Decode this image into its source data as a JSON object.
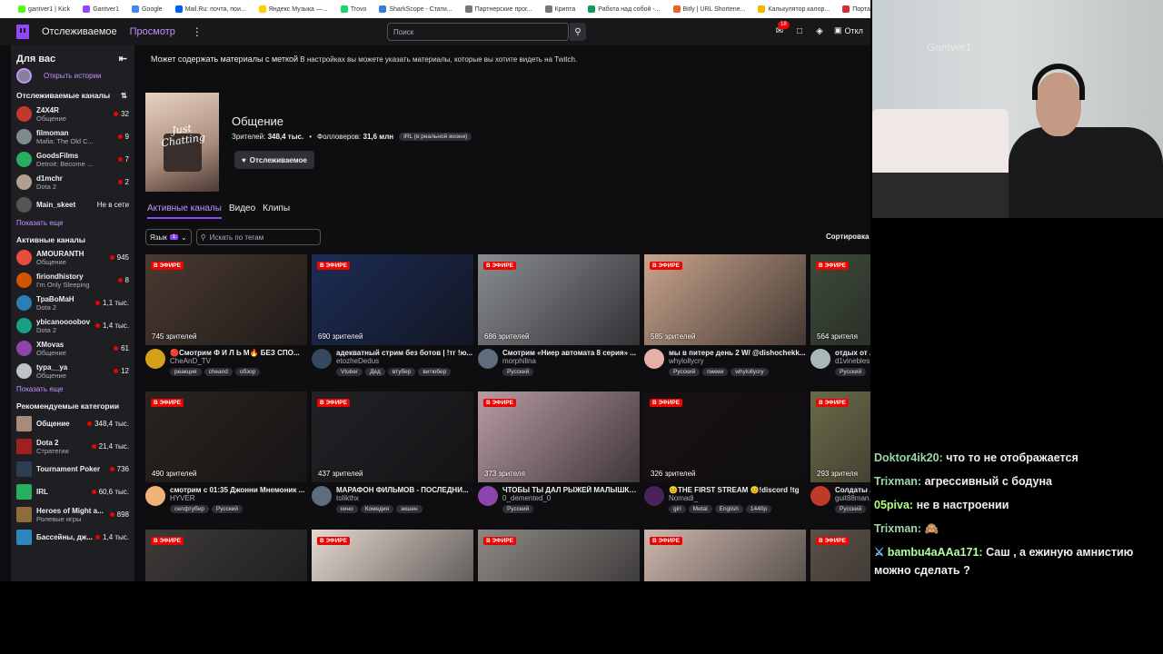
{
  "browser": {
    "bookmarks": [
      {
        "label": "gantver1 | Kick",
        "color": "#53fc18"
      },
      {
        "label": "Gantver1",
        "color": "#9147ff"
      },
      {
        "label": "Google",
        "color": "#4285f4"
      },
      {
        "label": "Mail.Ru: почта, пои...",
        "color": "#005ff9"
      },
      {
        "label": "Яндекс Музыка —...",
        "color": "#ffcc00"
      },
      {
        "label": "Trovo",
        "color": "#19d66b"
      },
      {
        "label": "SharkScope - Стати...",
        "color": "#3a7bd5"
      },
      {
        "label": "Партнерские прог...",
        "color": "#777777"
      },
      {
        "label": "Крипта",
        "color": "#777777"
      },
      {
        "label": "Работа над собой -...",
        "color": "#0f9d58"
      },
      {
        "label": "Bitly | URL Shortene...",
        "color": "#ee6123"
      },
      {
        "label": "Калькулятор калор...",
        "color": "#f4b400"
      },
      {
        "label": "Портал государс...",
        "color": "#d32f2f"
      }
    ]
  },
  "topnav": {
    "following": "Отслеживаемое",
    "browse": "Просмотр",
    "search_placeholder": "Поиск",
    "notifications_count": "18",
    "button_label": "Откл"
  },
  "sidebar": {
    "for_you": "Для вас",
    "open_stories": "Открыть истории",
    "followed_title": "Отслеживаемые каналы",
    "followed": [
      {
        "name": "Z4X4R",
        "game": "Общение",
        "count": "32",
        "color": "#c0392b"
      },
      {
        "name": "filmoman",
        "game": "Mafia: The Old C...",
        "count": "9",
        "color": "#7f8c8d"
      },
      {
        "name": "GoodsFilms",
        "game": "Detroit: Become ...",
        "count": "7",
        "color": "#27ae60"
      },
      {
        "name": "d1mchr",
        "game": "Dota 2",
        "count": "2",
        "color": "#b0a090"
      },
      {
        "name": "Main_skeet",
        "game": "",
        "count": "Не в сети",
        "offline": true,
        "color": "#555"
      }
    ],
    "show_more_1": "Показать еще",
    "active_title": "Активные каналы",
    "active": [
      {
        "name": "AMOURANTH",
        "game": "Общение",
        "count": "945",
        "color": "#e74c3c"
      },
      {
        "name": "firiondhistory",
        "game": "I'm Only Sleeping",
        "count": "8",
        "color": "#d35400"
      },
      {
        "name": "ТраВоМаН",
        "game": "Dota 2",
        "count": "1,1 тыс.",
        "color": "#2980b9"
      },
      {
        "name": "ybicanoooobov",
        "game": "Dota 2",
        "count": "1,4 тыс.",
        "color": "#16a085"
      },
      {
        "name": "XMovas",
        "game": "Общение",
        "count": "61",
        "color": "#8e44ad"
      },
      {
        "name": "typa__ya",
        "game": "Общение",
        "count": "12",
        "color": "#bdc3c7"
      }
    ],
    "show_more_2": "Показать еще",
    "recommended_title": "Рекомендуемые категории",
    "categories": [
      {
        "name": "Общение",
        "game": "",
        "count": "348,4 тыс.",
        "color": "#a98b7a"
      },
      {
        "name": "Dota 2",
        "game": "Стратегии",
        "count": "21,4 тыс.",
        "color": "#a02020"
      },
      {
        "name": "Tournament Poker",
        "game": "",
        "count": "736",
        "color": "#2c3e50"
      },
      {
        "name": "IRL",
        "game": "",
        "count": "60,6 тыс.",
        "color": "#27ae60"
      },
      {
        "name": "Heroes of Might a...",
        "game": "Ролевые игры",
        "count": "898",
        "color": "#8e6d3a"
      },
      {
        "name": "Бассейны, дж...",
        "game": "",
        "count": "1,4 тыс.",
        "color": "#2e86c1"
      }
    ]
  },
  "main": {
    "banner_bold": "Может содержать материалы с меткой",
    "banner_rest": " В настройках вы можете указать материалы, которые вы хотите видеть на Twitch.",
    "category_art_text": "Just Chatting",
    "category_title": "Общение",
    "viewers_label": "Зрителей:",
    "viewers_value": "348,4 тыс.",
    "followers_label": "Фолловеров:",
    "followers_value": "31,6 млн",
    "category_tag": "IRL (в реальной жизни)",
    "follow_button": "Отслеживаемое",
    "tabs": [
      "Активные каналы",
      "Видео",
      "Клипы"
    ],
    "language_label": "Язык",
    "language_count": "1",
    "tag_search_placeholder": "Искать по тегам",
    "sort_label": "Сортировка",
    "live_label": "В ЭФИРЕ",
    "streams": [
      {
        "viewers": "745 зрителей",
        "title": "🔴Смотрим Ф И Л Ь М🔥 БЕЗ СПО...",
        "channel": "CheAnD_TV",
        "tags": [
          "реакция",
          "cheand",
          "обзор"
        ],
        "bg": "#4a3a30",
        "av": "#d4a017"
      },
      {
        "viewers": "690 зрителей",
        "title": "адекватный стрим без ботов | !тг !ю...",
        "channel": "etozheDedus",
        "tags": [
          "Vtuber",
          "Дед",
          "втубер",
          "витюбер"
        ],
        "bg": "#1d2c55",
        "av": "#34495e"
      },
      {
        "viewers": "686 зрителей",
        "title": "Смотрим «Ниер автомата 8 серия» ...",
        "channel": "morphilina",
        "tags": [
          "Русский"
        ],
        "bg": "#8a8d90",
        "av": "#5d6d7e"
      },
      {
        "viewers": "585 зрителей",
        "title": "мы в питере день 2 W/ @dishochekk...",
        "channel": "whylollycry",
        "tags": [
          "Русский",
          "пикми",
          "whylollycry"
        ],
        "bg": "#c9a48c",
        "av": "#e6b0aa"
      },
      {
        "viewers": "564 зрителя",
        "title": "отдых от ...",
        "channel": "d1vinebles...",
        "tags": [
          "Русский"
        ],
        "bg": "#3e4a3a",
        "av": "#aab7b8"
      },
      {
        "viewers": "490 зрителей",
        "title": "смотрим с 01:35 Джонни Мнемоник ...",
        "channel": "HYVER",
        "tags": [
          "селфтубер",
          "Русский"
        ],
        "bg": "#2a2420",
        "av": "#f0b27a"
      },
      {
        "viewers": "437 зрителей",
        "title": "МАРАФОН ФИЛЬМОВ - ПОСЛЕДНИ...",
        "channel": "tolikthx",
        "tags": [
          "кино",
          "Комедия",
          "экшен"
        ],
        "bg": "#222226",
        "av": "#5d6d7e"
      },
      {
        "viewers": "373 зрителя",
        "title": "ЧТОБЫ ТЫ ДАЛ РЫЖЕЙ МАЛЫШКЕ...",
        "channel": "0_demented_0",
        "tags": [
          "Русский"
        ],
        "bg": "#b89aa4",
        "av": "#8e44ad"
      },
      {
        "viewers": "326 зрителей",
        "title": "😊THE FIRST STREAM 😊!discord !tg",
        "channel": "Nomadi_",
        "tags": [
          "girl",
          "Metal",
          "English",
          "1440p"
        ],
        "bg": "#161014",
        "av": "#4a235a"
      },
      {
        "viewers": "293 зрителя",
        "title": "Солдаты ...",
        "channel": "guit88man...",
        "tags": [
          "Русский"
        ],
        "bg": "#6b6a4a",
        "av": "#c0392b"
      },
      {
        "viewers": "",
        "title": "",
        "channel": "",
        "tags": [],
        "bg": "#3d3a38",
        "av": "#444"
      },
      {
        "viewers": "",
        "title": "",
        "channel": "",
        "tags": [],
        "bg": "#e4d8cf",
        "av": "#444"
      },
      {
        "viewers": "",
        "title": "",
        "channel": "",
        "tags": [],
        "bg": "#8c8782",
        "av": "#444"
      },
      {
        "viewers": "",
        "title": "",
        "channel": "",
        "tags": [],
        "bg": "#cdb7ac",
        "av": "#444"
      },
      {
        "viewers": "",
        "title": "",
        "channel": "",
        "tags": [],
        "bg": "#5a5148",
        "av": "#444"
      }
    ]
  },
  "webcam": {
    "watermark": "Gantver1"
  },
  "chat": {
    "messages": [
      {
        "user": "Doktor4ik20:",
        "text": " что то не отображается",
        "color": "#9bd7a8",
        "badge": false
      },
      {
        "user": "Trixman:",
        "text": " агрессивный с бодуна",
        "color": "#9bd7a8",
        "badge": false
      },
      {
        "user": "05piva:",
        "text": " не в настроении",
        "color": "#b4ff82",
        "badge": false
      },
      {
        "user": "Trixman:",
        "text": " 🙈",
        "color": "#9bd7a8",
        "badge": false
      },
      {
        "user": "bambu4aAAa171:",
        "text": " Саш , а ежиную амнистию можно сделать ?",
        "color": "#b0ff9c",
        "badge": true
      }
    ]
  }
}
